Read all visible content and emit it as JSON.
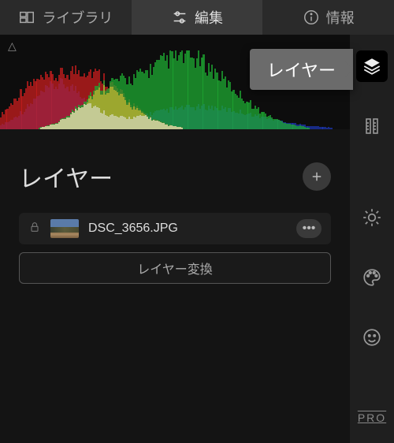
{
  "tabs": {
    "library": "ライブラリ",
    "edit": "編集",
    "info": "情報"
  },
  "tooltip": {
    "layers": "レイヤー"
  },
  "layers": {
    "title": "レイヤー",
    "item": {
      "name": "DSC_3656.JPG"
    },
    "convert": "レイヤー変換"
  },
  "sidebar": {
    "pro": "PRO"
  }
}
